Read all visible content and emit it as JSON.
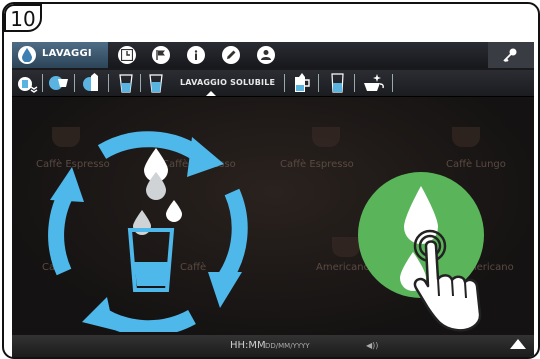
{
  "step_number": "10",
  "topbar": {
    "active_tab_label": "LAVAGGI",
    "tabs": [
      {
        "name": "clock-icon"
      },
      {
        "name": "flag-icon"
      },
      {
        "name": "info-icon"
      },
      {
        "name": "pencil-icon"
      },
      {
        "name": "user-icon"
      }
    ],
    "key_icon": "key-icon"
  },
  "subbar": {
    "active_label": "LAVAGGIO SOLUBILE"
  },
  "background_products": [
    "Caffè Espresso",
    "Caffè Espresso",
    "Caffè Espresso",
    "Caffè Lungo",
    "Caffè",
    "Caffè",
    "Americano",
    "Americano"
  ],
  "bottombar": {
    "time": "HH:MM",
    "date": "DD/MM/YYYY",
    "volume": "◀))"
  },
  "colors": {
    "accent_blue": "#4fb8ea",
    "accent_green": "#5ab55a"
  }
}
